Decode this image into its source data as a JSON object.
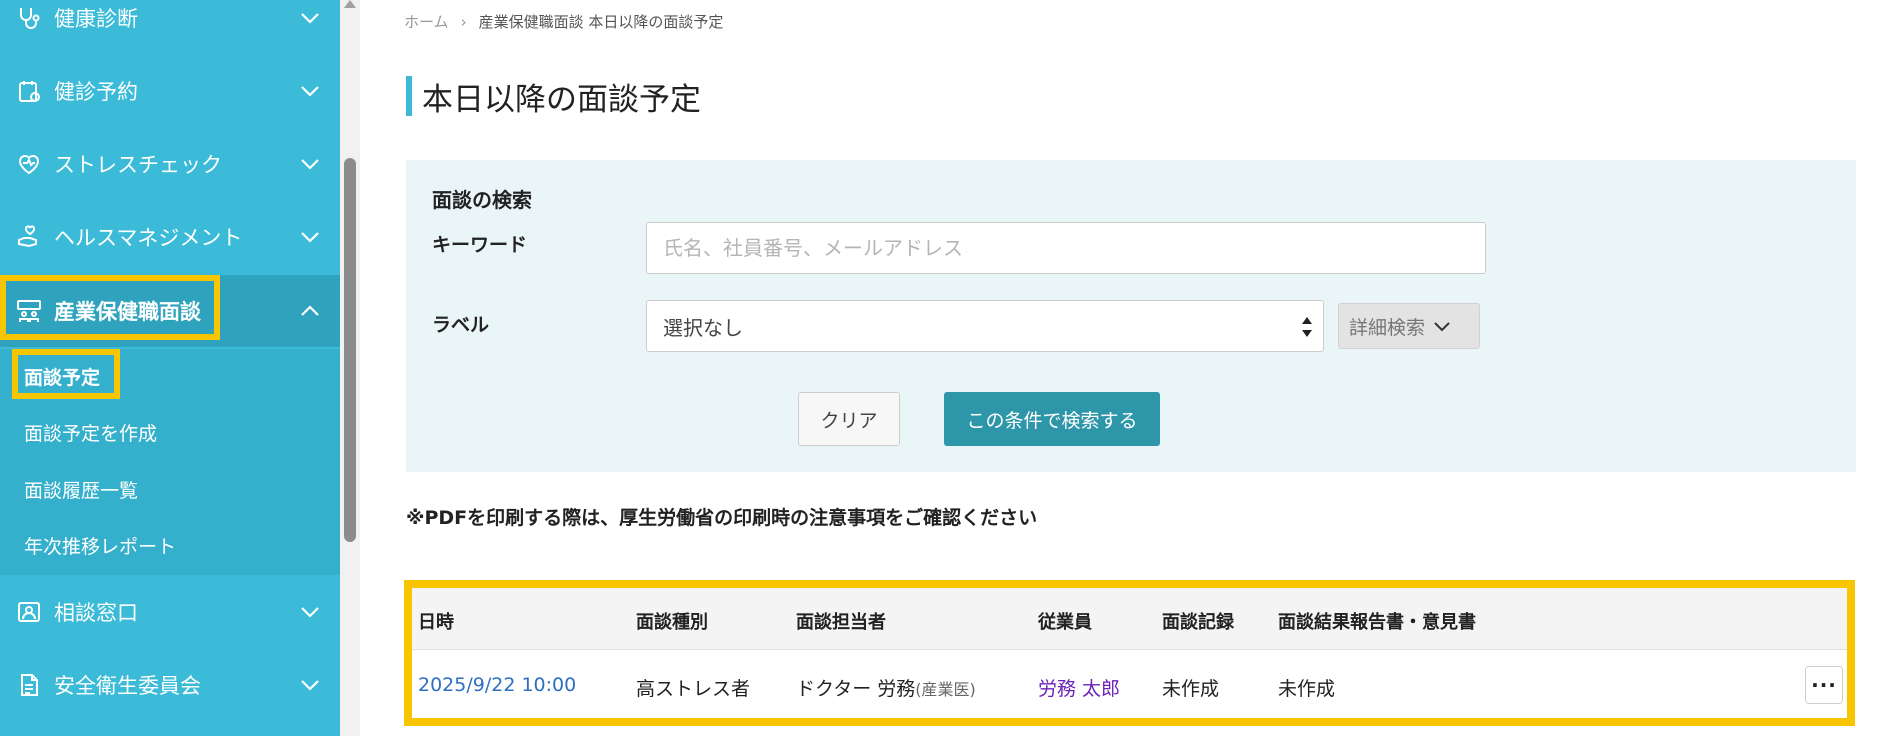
{
  "sidebar": {
    "items": [
      {
        "label": "健康診断",
        "icon": "stethoscope-icon"
      },
      {
        "label": "健診予約",
        "icon": "reservation-icon"
      },
      {
        "label": "ストレスチェック",
        "icon": "heart-icon"
      },
      {
        "label": "ヘルスマネジメント",
        "icon": "hand-heart-icon"
      },
      {
        "label": "産業保健職面談",
        "icon": "interview-icon"
      },
      {
        "label": "相談窓口",
        "icon": "consultation-icon"
      },
      {
        "label": "安全衛生委員会",
        "icon": "committee-document-icon"
      }
    ],
    "submenu": [
      "面談予定",
      "面談予定を作成",
      "面談履歴一覧",
      "年次推移レポート"
    ]
  },
  "breadcrumb": {
    "home": "ホーム",
    "separator": "›",
    "current": "産業保健職面談 本日以降の面談予定"
  },
  "page_title": "本日以降の面談予定",
  "search": {
    "title": "面談の検索",
    "keyword_label": "キーワード",
    "keyword_placeholder": "氏名、社員番号、メールアドレス",
    "label_label": "ラベル",
    "label_selected": "選択なし",
    "advanced_label": "詳細検索",
    "clear_label": "クリア",
    "submit_label": "この条件で検索する"
  },
  "notice": "※PDFを印刷する際は、厚生労働省の印刷時の注意事項をご確認ください",
  "table": {
    "headers": [
      "日時",
      "面談種別",
      "面談担当者",
      "従業員",
      "面談記録",
      "面談結果報告書・意見書"
    ],
    "rows": [
      {
        "datetime": "2025/9/22 10:00",
        "type": "高ストレス者",
        "staff": "ドクター 労務",
        "staff_role": "(産業医)",
        "employee": "労務 太郎",
        "record": "未作成",
        "report": "未作成",
        "more": "···"
      }
    ]
  },
  "colors": {
    "sidebar": "#3bbbd8",
    "highlight": "#f7c600",
    "primary_button": "#2e96a9",
    "panel": "#eaf5f8"
  }
}
